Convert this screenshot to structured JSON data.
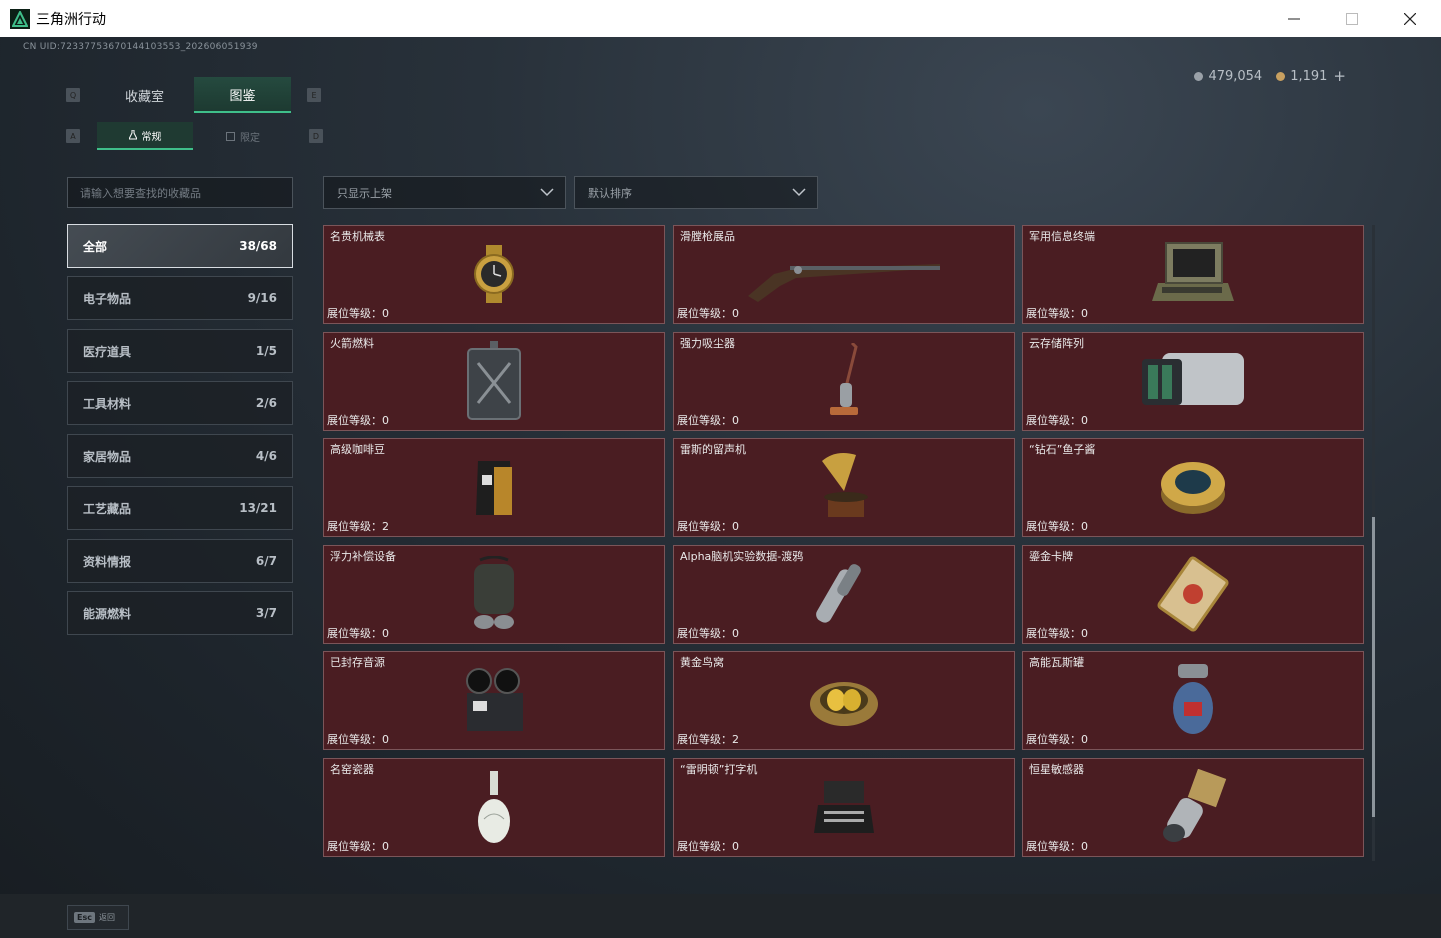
{
  "window": {
    "title": "三角洲行动",
    "controls": [
      "minimize",
      "maximize",
      "close"
    ]
  },
  "uid": "CN UID:7233775367014410355​3_202606051939",
  "currency": {
    "coins": "479,054",
    "bonds": "1,191",
    "add": "+",
    "coin_color": "#9aa1a8",
    "bond_color": "#c8a060"
  },
  "tabs": {
    "left_key": "Q",
    "right_key": "E",
    "items": [
      {
        "label": "收藏室",
        "active": false
      },
      {
        "label": "图鉴",
        "active": true
      }
    ]
  },
  "subtabs": {
    "left_key": "A",
    "right_key": "D",
    "items": [
      {
        "label": "常规",
        "active": true,
        "icon": "flask-icon"
      },
      {
        "label": "限定",
        "active": false,
        "icon": "box-icon"
      }
    ]
  },
  "search": {
    "placeholder": "请输入想要查找的收藏品"
  },
  "filters": {
    "display": "只显示上架",
    "sort": "默认排序"
  },
  "categories": [
    {
      "label": "全部",
      "count": "38/68",
      "active": true
    },
    {
      "label": "电子物品",
      "count": "9/16"
    },
    {
      "label": "医疗道具",
      "count": "1/5"
    },
    {
      "label": "工具材料",
      "count": "2/6"
    },
    {
      "label": "家居物品",
      "count": "4/6"
    },
    {
      "label": "工艺藏品",
      "count": "13/21"
    },
    {
      "label": "资料情报",
      "count": "6/7"
    },
    {
      "label": "能源燃料",
      "count": "3/7"
    }
  ],
  "level_label": "展位等级：",
  "items": [
    {
      "name": "名贵机械表",
      "level": "0",
      "icon": "watch-icon"
    },
    {
      "name": "滑膛枪展品",
      "level": "0",
      "icon": "musket-icon"
    },
    {
      "name": "军用信息终端",
      "level": "0",
      "icon": "terminal-icon"
    },
    {
      "name": "火箭燃料",
      "level": "0",
      "icon": "fuel-can-icon"
    },
    {
      "name": "强力吸尘器",
      "level": "0",
      "icon": "vacuum-icon"
    },
    {
      "name": "云存储阵列",
      "level": "0",
      "icon": "storage-array-icon"
    },
    {
      "name": "高级咖啡豆",
      "level": "2",
      "icon": "coffee-bag-icon"
    },
    {
      "name": "雷斯的留声机",
      "level": "0",
      "icon": "gramophone-icon"
    },
    {
      "name": "“钻石”鱼子酱",
      "level": "0",
      "icon": "caviar-tin-icon"
    },
    {
      "name": "浮力补偿设备",
      "level": "0",
      "icon": "buoyancy-device-icon"
    },
    {
      "name": "Alpha脑机实验数据-渡鸦",
      "level": "0",
      "icon": "data-capsule-icon"
    },
    {
      "name": "鎏金卡牌",
      "level": "0",
      "icon": "gold-card-icon"
    },
    {
      "name": "已封存音源",
      "level": "0",
      "icon": "reel-recorder-icon"
    },
    {
      "name": "黄金鸟窝",
      "level": "2",
      "icon": "golden-nest-icon"
    },
    {
      "name": "高能瓦斯罐",
      "level": "0",
      "icon": "gas-canister-icon"
    },
    {
      "name": "名窑瓷器",
      "level": "0",
      "icon": "porcelain-vase-icon"
    },
    {
      "name": "“雷明顿”打字机",
      "level": "0",
      "icon": "typewriter-icon"
    },
    {
      "name": "恒星敏感器",
      "level": "0",
      "icon": "star-sensor-icon"
    }
  ],
  "footer": {
    "esc_key": "Esc",
    "esc_label": "返回"
  },
  "colors": {
    "card_bg": "#4a1d22",
    "card_border": "#7b5559",
    "accent": "#3fbf8a",
    "app_icon": "#3fbf8a"
  }
}
